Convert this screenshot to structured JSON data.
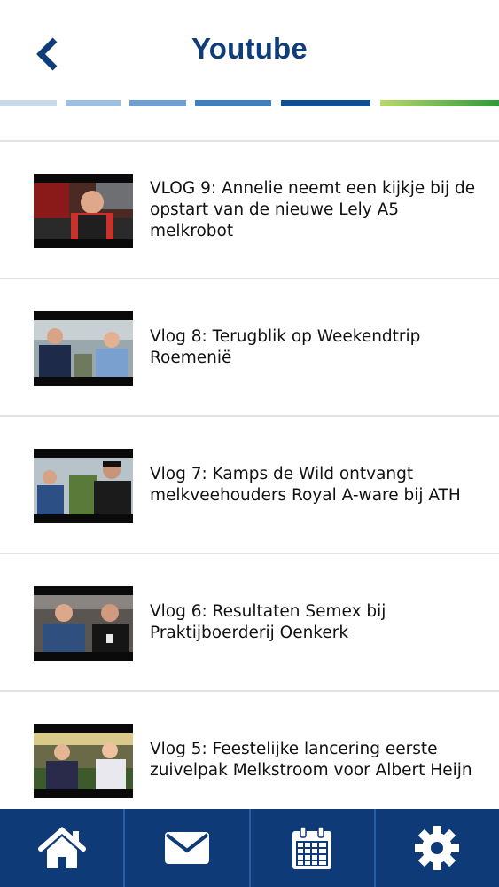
{
  "header": {
    "title": "Youtube",
    "back_icon": "chevron-left-icon"
  },
  "colors": {
    "brand_blue": "#0f3d7a",
    "tabbar_bg": "#0e3a78",
    "stripe_colors": [
      "#c9d9ea",
      "#9fbfe0",
      "#6f9fd0",
      "#3f7fc0",
      "#0f4f95",
      "#8cc43c"
    ]
  },
  "videos": [
    {
      "title": "VLOG 9: Annelie neemt een kijkje bij de opstart van de nieuwe Lely A5 melkrobot"
    },
    {
      "title": "Vlog 8: Terugblik op Weekendtrip Roemenië"
    },
    {
      "title": "Vlog 7: Kamps de Wild ontvangt melkveehouders Royal A-ware bij ATH"
    },
    {
      "title": "Vlog 6: Resultaten Semex bij Praktijboerderij Oenkerk"
    },
    {
      "title": "Vlog 5: Feestelijke lancering eerste zuivelpak Melkstroom voor Albert Heijn"
    }
  ],
  "tabbar": {
    "tabs": [
      {
        "icon": "home-icon"
      },
      {
        "icon": "mail-icon"
      },
      {
        "icon": "calendar-icon"
      },
      {
        "icon": "settings-icon"
      }
    ]
  }
}
